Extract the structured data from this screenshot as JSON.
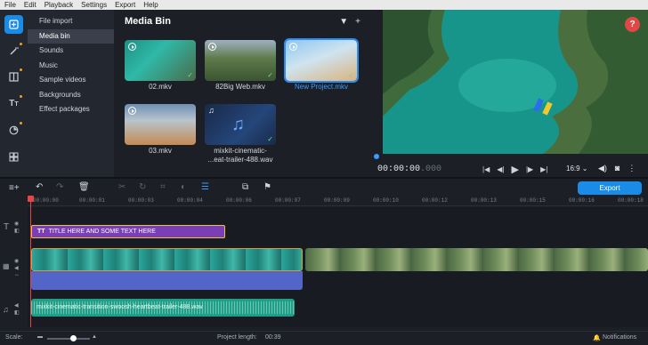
{
  "menu": [
    "File",
    "Edit",
    "Playback",
    "Settings",
    "Export",
    "Help"
  ],
  "left_tools": [
    "import-icon",
    "magic-wand-icon",
    "layout-icon",
    "text-icon",
    "clock-icon",
    "grid-icon"
  ],
  "categories": [
    "File import",
    "Media bin",
    "Sounds",
    "Music",
    "Sample videos",
    "Backgrounds",
    "Effect packages"
  ],
  "media_bin": {
    "title": "Media Bin",
    "items": [
      {
        "label": "02.mkv",
        "type": "video"
      },
      {
        "label": "82Big Web.mkv",
        "type": "video"
      },
      {
        "label": "New Project.mkv",
        "type": "video",
        "selected": true
      },
      {
        "label": "03.mkv",
        "type": "video"
      },
      {
        "label": "mixkit-cinematic-",
        "label2": "...eat-trailer-488.wav",
        "type": "audio"
      }
    ]
  },
  "player": {
    "time_main": "00:00:00",
    "time_frac": ".000",
    "aspect": "16:9"
  },
  "toolbar": {
    "export_label": "Export"
  },
  "ruler": [
    "00:00:00",
    "00:00:01",
    "00:00:03",
    "00:00:04",
    "00:00:06",
    "00:00:07",
    "00:00:09",
    "00:00:10",
    "00:00:12",
    "00:00:13",
    "00:00:15",
    "00:00:16",
    "00:00:18"
  ],
  "timeline": {
    "title_clip": "TITLE HERE AND SOME TEXT HERE",
    "audio_clip": "mixkit-cinematic-transition-swoosh-heartbeat-trailer-488.wav"
  },
  "status": {
    "scale_label": "Scale:",
    "scale_fraction": 0.62,
    "project_length_label": "Project length:",
    "project_length": "00:39",
    "notifications": "Notifications"
  },
  "colors": {
    "accent": "#1a8ce8",
    "title_clip": "#7a3fb4",
    "audio_clip": "#1f9e88",
    "video_audio": "#5366c8"
  }
}
